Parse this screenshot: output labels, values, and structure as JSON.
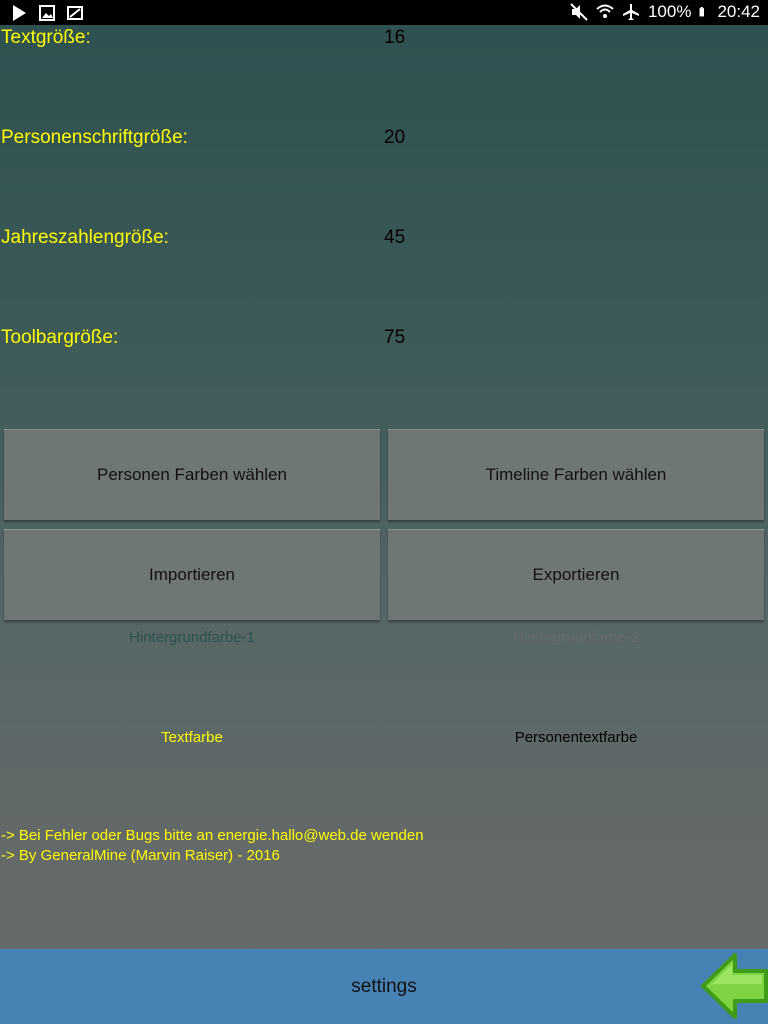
{
  "status_bar": {
    "battery": "100%",
    "time": "20:42",
    "left_icons": [
      "play-icon",
      "image-icon",
      "gallery-icon"
    ],
    "right_icons": [
      "mute-icon",
      "wifi-icon",
      "airplane-icon",
      "battery-icon"
    ]
  },
  "settings": [
    {
      "label": "Textgröße:",
      "value": "16"
    },
    {
      "label": "Personenschriftgröße:",
      "value": "20"
    },
    {
      "label": "Jahreszahlengröße:",
      "value": "45"
    },
    {
      "label": "Toolbargröße:",
      "value": "75"
    }
  ],
  "buttons": {
    "person_colors": "Personen Farben wählen",
    "timeline_colors": "Timeline Farben wählen",
    "import": "Importieren",
    "export": "Exportieren"
  },
  "color_options": {
    "background1": {
      "label": "Hintergrundfarbe-1",
      "color": "#2e5050"
    },
    "background2": {
      "label": "Hintergrundfarbe-2",
      "color": "#676a6a"
    },
    "text": {
      "label": "Textfarbe",
      "color": "#ffff00"
    },
    "person_text": {
      "label": "Personentextfarbe",
      "color": "#000000"
    }
  },
  "footer": {
    "line1": "-> Bei Fehler oder Bugs bitte an energie.hallo@web.de wenden",
    "line2": "-> By GeneralMine (Marvin Raiser) - 2016"
  },
  "toolbar": {
    "title": "settings",
    "color": "#4682b4",
    "back_icon": "back-arrow-icon"
  }
}
